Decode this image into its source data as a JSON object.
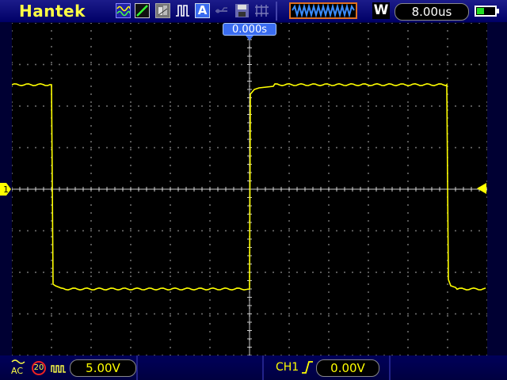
{
  "header": {
    "brand": "Hantek",
    "auto_label": "A",
    "mem_label": "W",
    "timebase": "8.00us",
    "battery_fraction": 0.45
  },
  "screen": {
    "trigger_position": "0.000s",
    "channel_marker": "1",
    "trace_color": "#ffff00",
    "grid_color": "#888888"
  },
  "footer": {
    "coupling": "AC",
    "bw_limit": "20",
    "volts_per_div": "5.00V",
    "trigger_source": "CH1",
    "trigger_level": "0.00V"
  },
  "icons": [
    "waveform-icon",
    "slope-icon",
    "persist-icon",
    "pulse-icon",
    "auto-icon",
    "usb-icon",
    "save-icon",
    "ruler-icon",
    "battery-icon",
    "probe-icon",
    "rising-edge-icon"
  ]
}
